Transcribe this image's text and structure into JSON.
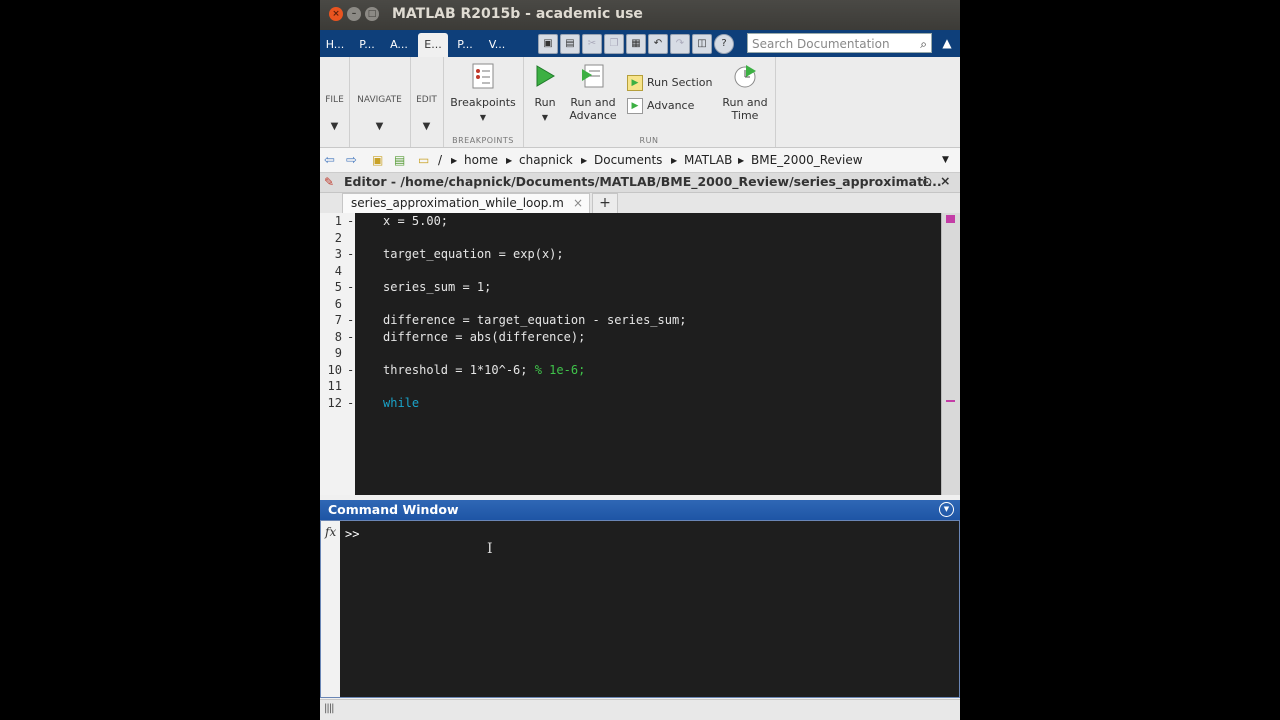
{
  "window": {
    "title": "MATLAB R2015b - academic use",
    "close_glyph": "×",
    "minimize_glyph": "–",
    "maximize_glyph": "□"
  },
  "toolstrip_tabs": [
    {
      "label": "H..."
    },
    {
      "label": "P..."
    },
    {
      "label": "A..."
    },
    {
      "label": "E..."
    },
    {
      "label": "P..."
    },
    {
      "label": "V..."
    }
  ],
  "search": {
    "placeholder": "Search Documentation"
  },
  "ribbon": {
    "file_label": "FILE",
    "navigate_label": "NAVIGATE",
    "edit_label": "EDIT",
    "breakpoints_label": "Breakpoints",
    "breakpoints_group": "BREAKPOINTS",
    "run_label": "Run",
    "run_advance_line1": "Run and",
    "run_advance_line2": "Advance",
    "run_section_label": "Run Section",
    "advance_label": "Advance",
    "run_time_line1": "Run and",
    "run_time_line2": "Time",
    "run_group": "RUN"
  },
  "address_bar": {
    "root": "/",
    "segments": [
      "home",
      "chapnick",
      "Documents",
      "MATLAB",
      "BME_2000_Review"
    ]
  },
  "editor": {
    "header": "Editor - /home/chapnick/Documents/MATLAB/BME_2000_Review/series_approximati...",
    "file_tab": "series_approximation_while_loop.m",
    "lines": [
      {
        "n": "1",
        "dash": "-",
        "code": "x = 5.00;",
        "comment": ""
      },
      {
        "n": "2",
        "dash": "",
        "code": "",
        "comment": ""
      },
      {
        "n": "3",
        "dash": "-",
        "code": "target_equation = exp(x);",
        "comment": ""
      },
      {
        "n": "4",
        "dash": "",
        "code": "",
        "comment": ""
      },
      {
        "n": "5",
        "dash": "-",
        "code": "series_sum = 1;",
        "comment": ""
      },
      {
        "n": "6",
        "dash": "",
        "code": "",
        "comment": ""
      },
      {
        "n": "7",
        "dash": "-",
        "code": "difference = target_equation - series_sum;",
        "comment": ""
      },
      {
        "n": "8",
        "dash": "-",
        "code": "differnce = abs(difference);",
        "comment": ""
      },
      {
        "n": "9",
        "dash": "",
        "code": "",
        "comment": ""
      },
      {
        "n": "10",
        "dash": "-",
        "code": "threshold = 1*10^-6; ",
        "comment": "% 1e-6;"
      },
      {
        "n": "11",
        "dash": "",
        "code": "",
        "comment": ""
      },
      {
        "n": "12",
        "dash": "-",
        "code": "",
        "comment": "",
        "keyword": "while"
      }
    ]
  },
  "command_window": {
    "title": "Command Window",
    "fx": "fx",
    "prompt": ">>"
  },
  "status_bar": {
    "grip": "||||"
  },
  "colors": {
    "editor_bg": "#1e1e1e",
    "keyword": "#1aa3c9",
    "comment": "#3fc34a",
    "title_bar": "#3c3b37",
    "tab_strip": "#0e3f7a",
    "command_header": "#1e55a5"
  }
}
